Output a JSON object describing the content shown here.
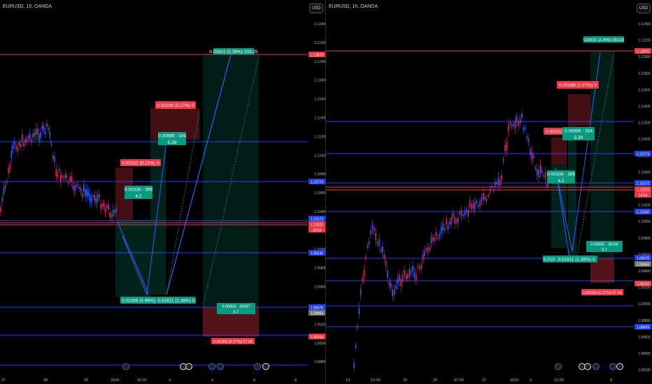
{
  "left": {
    "title": "EURUSD, 15, OANDA",
    "currency_button": "USD",
    "price_labels": [
      "1.12400",
      "1.12200",
      "1.12000",
      "1.11800",
      "1.11600",
      "1.11400",
      "1.11200",
      "1.11000",
      "1.10800",
      "1.10600",
      "1.10400",
      "1.10200",
      "1.10000",
      "1.09800",
      "1.09600",
      "1.09400",
      "1.09200",
      "1.09000",
      "1.08800"
    ],
    "level_labels": [
      "1.13075",
      "1.10774",
      "1.10172",
      "1.10322",
      "14:54",
      "1.09242",
      "1.09476",
      "1.09464",
      "1.09164"
    ],
    "time_labels": [
      "27",
      "28",
      "29",
      "2024",
      "06:00",
      "3",
      "4",
      "5",
      "8"
    ],
    "boxes": [
      "0.00252 (0.23%) 0",
      "0.00299 (0.27%) 0",
      "0.00889 - 334",
      "5.39",
      "0.00336 - 396",
      "4.2",
      "0.02611 (2.39%) 203.25",
      "0.01058 (0.96%)",
      "0.01611 (1.45%) 0",
      "0.00858 - 38287",
      "8.7",
      "0.00300 (0.27%) 97.65"
    ]
  },
  "right": {
    "title": "EURUSD, 1h, OANDA",
    "currency_button": "USD",
    "price_labels": [
      "1.12400",
      "1.12200",
      "1.12000",
      "1.11800",
      "1.11600",
      "1.11400",
      "1.11200",
      "1.11000",
      "1.10800",
      "1.10600",
      "1.10400",
      "1.10200",
      "1.10000",
      "1.09800",
      "1.09600",
      "1.09400",
      "1.09200",
      "1.09000",
      "1.08800",
      "1.08600",
      "1.08400",
      "1.08200"
    ],
    "level_labels": [
      "1.13075",
      "1.10774",
      "1.10172",
      "1.10322",
      "14:54",
      "1.10242",
      "1.09476",
      "1.09464",
      "1.09164",
      "1.08609"
    ],
    "time_labels": [
      "13",
      "12:00",
      "15",
      "20",
      "07:00",
      "27",
      "2024",
      "3",
      "12:00",
      "8"
    ],
    "boxes": [
      "0.02611 (2.39%) 202.93",
      "0.00299 (0.27%) 0",
      "0.00252",
      "0.00889 - 334",
      "5.39",
      "0.00336 - 396",
      "4.2",
      "0.00858 - 36166",
      "8.7",
      "0.010",
      "0.01611 (1.45%) 0",
      "0.00300 (0.27%) 97.65"
    ]
  },
  "colors": {
    "red": "#f23645",
    "green": "#089981",
    "blue": "#2962ff",
    "navy": "#1f3fff",
    "bg": "#000000"
  },
  "icons": [
    "lightning-icon",
    "flag-us-icon",
    "flag-eu-icon",
    "event-icon"
  ]
}
